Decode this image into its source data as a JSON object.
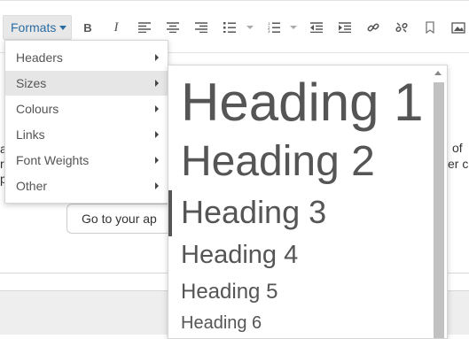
{
  "toolbar": {
    "formats_label": "Formats",
    "icons": [
      "bold-icon",
      "italic-icon",
      "align-left-icon",
      "align-center-icon",
      "align-right-icon",
      "bullet-list-icon",
      "numbered-list-icon",
      "outdent-icon",
      "indent-icon",
      "link-icon",
      "unlink-icon",
      "bookmark-icon",
      "image-icon"
    ],
    "bold_glyph": "B",
    "italic_glyph": "I"
  },
  "menu": {
    "items": [
      {
        "label": "Headers"
      },
      {
        "label": "Sizes"
      },
      {
        "label": "Colours"
      },
      {
        "label": "Links"
      },
      {
        "label": "Font Weights"
      },
      {
        "label": "Other"
      }
    ],
    "active_item": "Sizes"
  },
  "submenu": {
    "items": [
      {
        "label": "Heading 1"
      },
      {
        "label": "Heading 2"
      },
      {
        "label": "Heading 3"
      },
      {
        "label": "Heading 4"
      },
      {
        "label": "Heading 5"
      },
      {
        "label": "Heading 6"
      }
    ],
    "active_item": "Heading 3"
  },
  "editor": {
    "left_fragments": [
      "a",
      "r",
      "p"
    ],
    "right_fragments": [
      "of",
      "er c"
    ],
    "button_label": "Go to your ap"
  }
}
